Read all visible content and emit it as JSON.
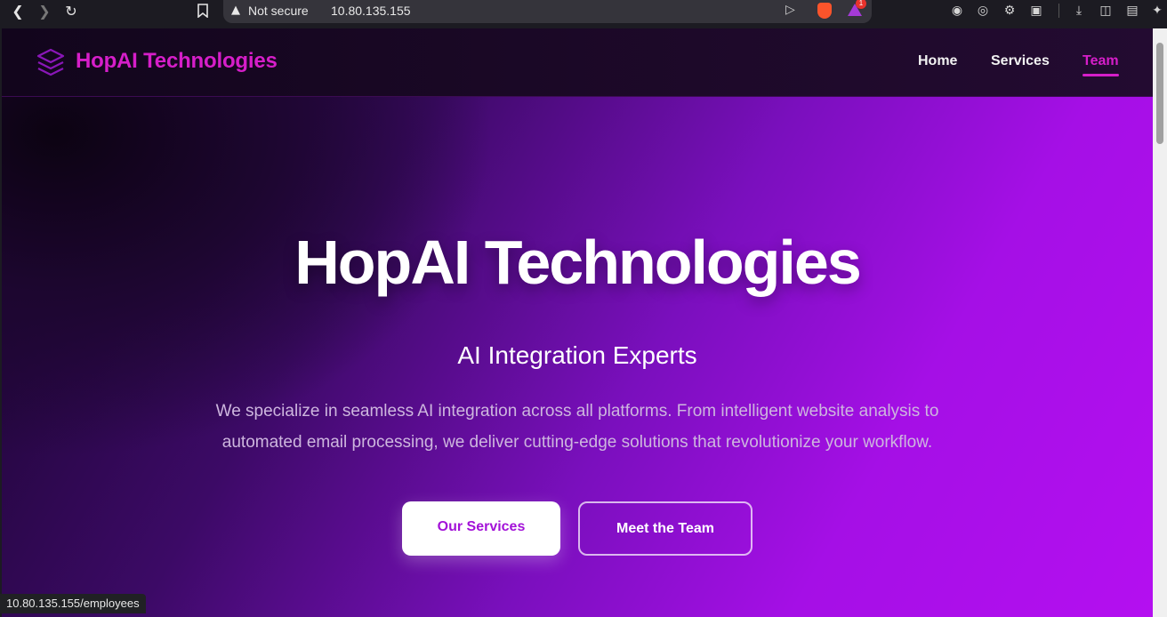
{
  "browser": {
    "security_label": "Not secure",
    "url": "10.80.135.155",
    "rewards_badge": "1",
    "icons": [
      "back-icon",
      "forward-icon",
      "reload-icon",
      "bookmark-icon",
      "warning-icon",
      "send-icon",
      "brave-shields-icon",
      "brave-rewards-icon",
      "leo-icon",
      "vpn-icon",
      "extensions-icon",
      "screenshot-icon",
      "download-icon",
      "sidebar-icon",
      "wallet-icon",
      "ai-icon"
    ]
  },
  "site": {
    "brand": "HopAI Technologies",
    "nav": [
      {
        "label": "Home"
      },
      {
        "label": "Services"
      },
      {
        "label": "Team"
      }
    ],
    "active_nav": "Team",
    "accent_color": "#d61ec9"
  },
  "hero": {
    "title": "HopAI Technologies",
    "subtitle": "AI Integration Experts",
    "description_line1": "We specialize in seamless AI integration across all platforms. From intelligent website analysis to",
    "description_line2": "automated email processing, we deliver cutting-edge solutions that revolutionize your workflow.",
    "primary_button": "Our Services",
    "secondary_button": "Meet the Team"
  },
  "status_bar": {
    "link": "10.80.135.155/employees"
  }
}
